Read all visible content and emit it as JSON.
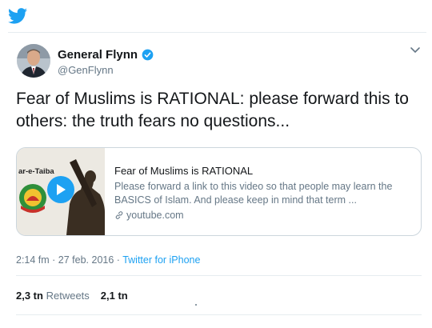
{
  "colors": {
    "accent": "#1da1f2",
    "text": "#14171a",
    "muted": "#657786",
    "border": "#ccd6dd"
  },
  "header": {
    "icon": "twitter-bird-icon"
  },
  "author": {
    "name": "General Flynn",
    "verified_icon": "verified-badge-icon",
    "handle": "@GenFlynn"
  },
  "tweet": {
    "text": "Fear of Muslims is RATIONAL: please forward this to others: the truth fears no questions..."
  },
  "link_card": {
    "thumb_caption": "ar-e-Taiba",
    "title": "Fear of Muslims is RATIONAL",
    "description": "Please forward a link to this video so that people may learn the BASICS of Islam. And please keep in mind that term ...",
    "domain": "youtube.com"
  },
  "meta": {
    "time_date": "2:14 fm · 27 feb. 2016 · ",
    "source": "Twitter for iPhone"
  },
  "stats": {
    "retweets_count": "2,3 tn",
    "retweets_label": "Retweets",
    "likes_count": "2,1 tn"
  }
}
